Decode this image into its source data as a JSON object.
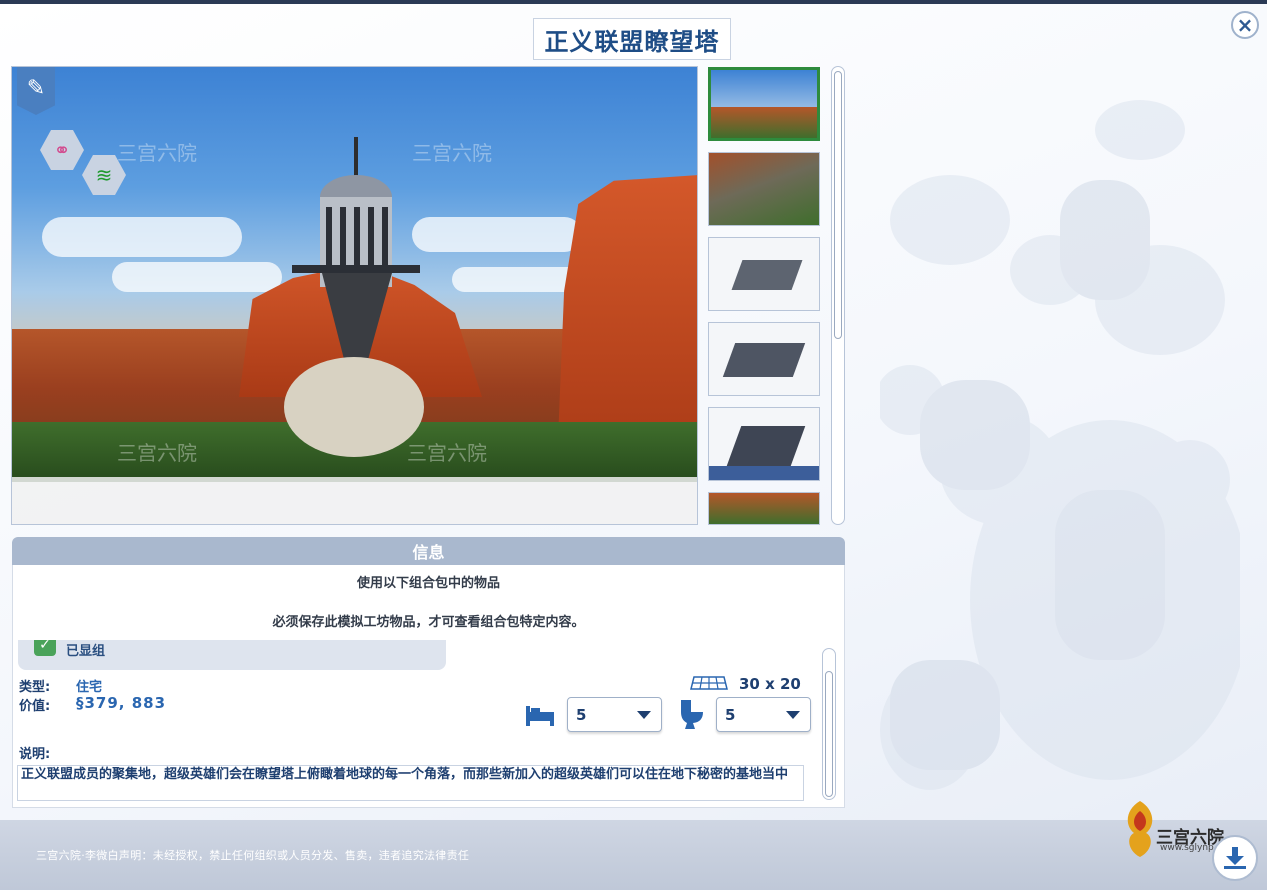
{
  "window": {
    "title": "正义联盟瞭望塔",
    "close_label": "×"
  },
  "gallery": {
    "selected_index": 0,
    "thumbnails": [
      "exterior-view",
      "aerial-view",
      "floorplan-level-1",
      "floorplan-level-2",
      "floorplan-level-3",
      "exterior-view-2"
    ]
  },
  "badges": {
    "tool": "wrench-icon",
    "traits": [
      "couple-icon",
      "wifi-icon"
    ]
  },
  "info": {
    "header": "信息",
    "pack_notice": "使用以下组合包中的物品",
    "save_notice": "必须保存此模拟工坊物品，才可查看组合包特定内容。",
    "pack_item_label": "已显组",
    "type_label": "类型:",
    "type_value": "住宅",
    "value_label": "价值:",
    "value_value": "§379, 883",
    "lot_size": "30 x 20",
    "bedrooms": "5",
    "bathrooms": "5",
    "description_label": "说明:",
    "description": "正义联盟成员的聚集地，超级英雄们会在瞭望塔上俯瞰着地球的每一个角落，而那些新加入的超级英雄们可以住在地下秘密的基地当中"
  },
  "footer": {
    "disclaimer": "三宫六院·李微白声明：未经授权，禁止任何组织或人员分发、售卖，违者追究法律责任",
    "logo_text": "三宫六院",
    "logo_url": "www.sglynp.com",
    "watermark_text": "三宫六院",
    "watermark_url": "www.sglynp.com"
  },
  "colors": {
    "accent": "#1e4d86",
    "header": "#a9b8ce",
    "selected": "#2e8b3d"
  }
}
